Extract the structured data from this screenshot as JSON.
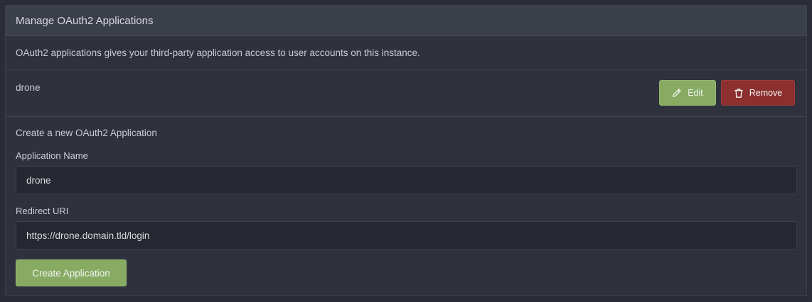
{
  "panel": {
    "title": "Manage OAuth2 Applications",
    "description": "OAuth2 applications gives your third-party application access to user accounts on this instance."
  },
  "applications": [
    {
      "name": "drone",
      "edit_label": "Edit",
      "remove_label": "Remove"
    }
  ],
  "form": {
    "title": "Create a new OAuth2 Application",
    "app_name_label": "Application Name",
    "app_name_value": "drone",
    "redirect_label": "Redirect URI",
    "redirect_value": "https://drone.domain.tld/login",
    "submit_label": "Create Application"
  },
  "colors": {
    "edit_green": "#87ab63",
    "remove_red": "#8b2f2f",
    "panel_bg": "#2f323d",
    "header_bg": "#3b3f4a"
  },
  "icons": {
    "edit": "pencil-icon",
    "remove": "trash-icon"
  }
}
